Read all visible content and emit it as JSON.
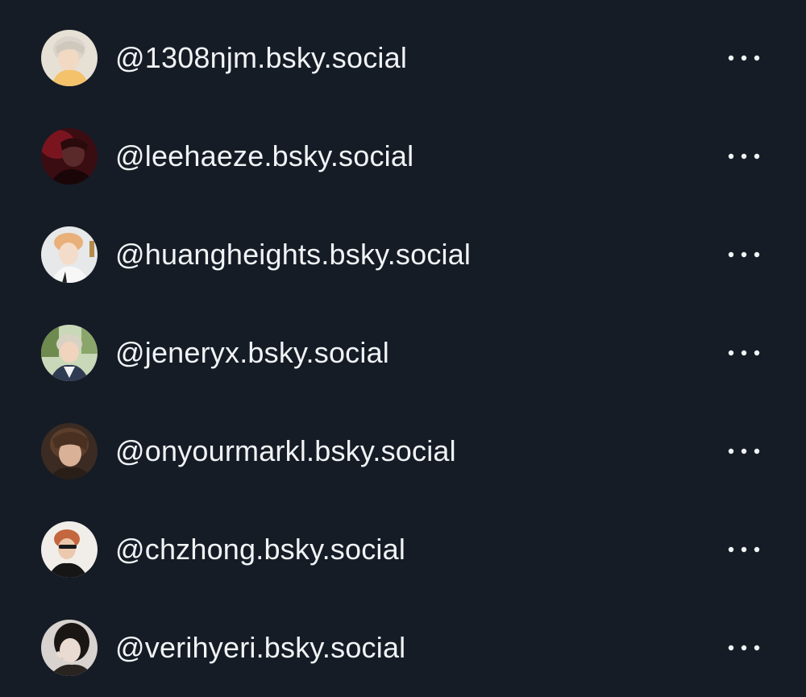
{
  "accounts": [
    {
      "handle": "@1308njm.bsky.social",
      "avatar": "avatar-photo"
    },
    {
      "handle": "@leehaeze.bsky.social",
      "avatar": "avatar-photo"
    },
    {
      "handle": "@huangheights.bsky.social",
      "avatar": "avatar-photo"
    },
    {
      "handle": "@jeneryx.bsky.social",
      "avatar": "avatar-photo"
    },
    {
      "handle": "@onyourmarkl.bsky.social",
      "avatar": "avatar-photo"
    },
    {
      "handle": "@chzhong.bsky.social",
      "avatar": "avatar-photo"
    },
    {
      "handle": "@verihyeri.bsky.social",
      "avatar": "avatar-photo"
    }
  ],
  "icons": {
    "more": "more-horizontal-icon"
  },
  "colors": {
    "background": "#151c26",
    "text": "#f1f3f5"
  }
}
